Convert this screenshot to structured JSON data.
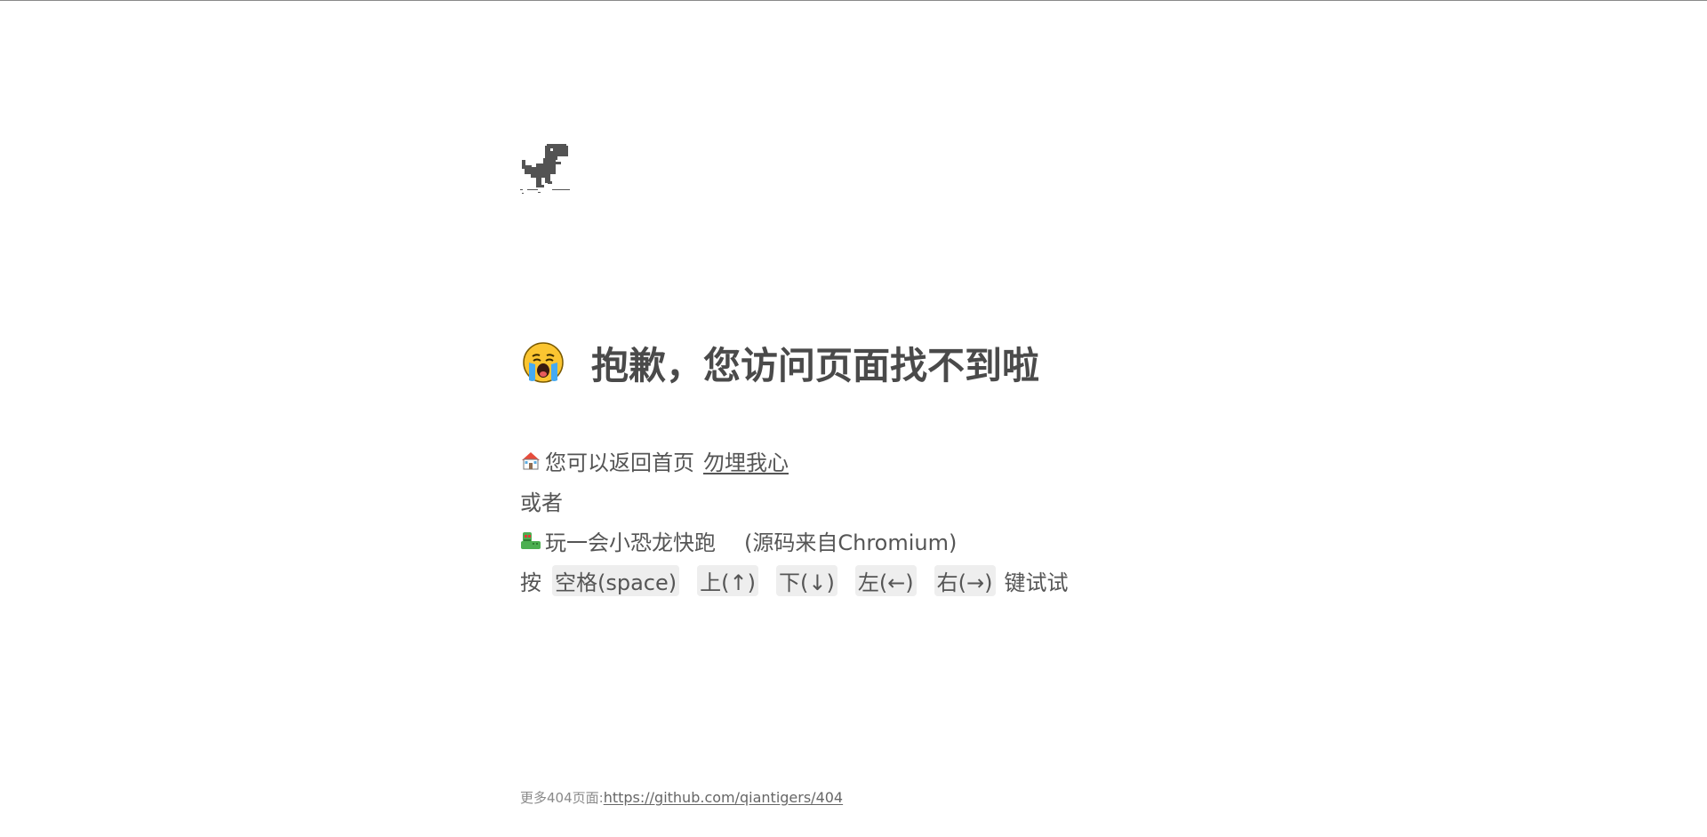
{
  "headline": {
    "icon": "crying-face-emoji",
    "text": "抱歉，您访问页面找不到啦"
  },
  "home_line": {
    "icon": "house-emoji",
    "text": "您可以返回首页",
    "link_text": "勿埋我心"
  },
  "or_line": {
    "text": "或者"
  },
  "game_line": {
    "icon": "dinosaur-emoji",
    "text": "玩一会小恐龙快跑",
    "note": "(源码来自Chromium)"
  },
  "keys_line": {
    "prefix": "按",
    "keys": [
      "空格(space)",
      "上(↑)",
      "下(↓)",
      "左(←)",
      "右(→)"
    ],
    "suffix": "键试试"
  },
  "footer": {
    "label": "更多404页面:",
    "link": "https://github.com/qiantigers/404"
  },
  "colors": {
    "text": "#555555",
    "heading": "#4a4a4a",
    "key_bg": "#eeeeee",
    "footer_text": "#8a8a8a"
  }
}
